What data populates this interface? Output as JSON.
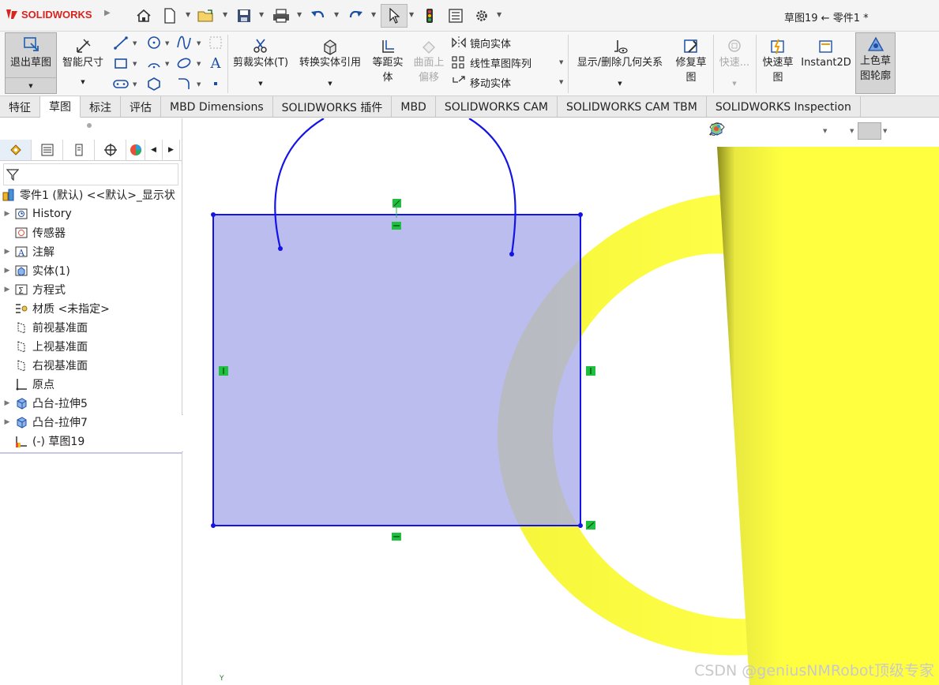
{
  "app": {
    "logo_text": "SOLIDWORKS",
    "title": "草图19 ← 零件1 *"
  },
  "quick_access": [
    "home-icon",
    "new-icon",
    "open-icon",
    "save-icon",
    "print-icon",
    "undo-icon",
    "redo-icon",
    "select-icon",
    "rebuild-icon",
    "file-properties-icon",
    "options-icon"
  ],
  "ribbon": {
    "exit_sketch": "退出草图",
    "smart_dimension": "智能尺寸",
    "trim": "剪裁实体(T)",
    "convert": "转换实体引用",
    "offset_line1": "等距实",
    "offset_line2": "体",
    "surface_offset_line1": "曲面上",
    "surface_offset_line2": "偏移",
    "mirror": "镜向实体",
    "linear_pattern": "线性草图阵列",
    "move": "移动实体",
    "display_relations": "显示/删除几何关系",
    "repair_line1": "修复草",
    "repair_line2": "图",
    "quick_snaps": "快速...",
    "rapid_line1": "快速草",
    "rapid_line2": "图",
    "instant2d": "Instant2D",
    "shaded_line1": "上色草",
    "shaded_line2": "图轮廓"
  },
  "tabs": [
    {
      "label": "特征",
      "active": false
    },
    {
      "label": "草图",
      "active": true
    },
    {
      "label": "标注",
      "active": false
    },
    {
      "label": "评估",
      "active": false
    },
    {
      "label": "MBD Dimensions",
      "active": false
    },
    {
      "label": "SOLIDWORKS 插件",
      "active": false
    },
    {
      "label": "MBD",
      "active": false
    },
    {
      "label": "SOLIDWORKS CAM",
      "active": false
    },
    {
      "label": "SOLIDWORKS CAM TBM",
      "active": false
    },
    {
      "label": "SOLIDWORKS Inspection",
      "active": false
    }
  ],
  "tree": {
    "root": "零件1 (默认) <<默认>_显示状",
    "items": [
      {
        "label": "History",
        "expandable": true
      },
      {
        "label": "传感器",
        "expandable": false
      },
      {
        "label": "注解",
        "expandable": true
      },
      {
        "label": "实体(1)",
        "expandable": true
      },
      {
        "label": "方程式",
        "expandable": true
      },
      {
        "label": "材质 <未指定>",
        "expandable": false
      },
      {
        "label": "前视基准面",
        "expandable": false
      },
      {
        "label": "上视基准面",
        "expandable": false
      },
      {
        "label": "右视基准面",
        "expandable": false
      },
      {
        "label": "原点",
        "expandable": false
      },
      {
        "label": "凸台-拉伸5",
        "expandable": true
      },
      {
        "label": "凸台-拉伸7",
        "expandable": true
      },
      {
        "label": "(-) 草图19",
        "expandable": false
      }
    ]
  },
  "colors": {
    "sketch_line": "#1414e6",
    "sketch_fill": "#b9bcef",
    "body_yellow": "#ffff40",
    "relation_green": "#1fbf3f",
    "logo_red": "#d8231f"
  },
  "watermark": "CSDN @geniusNMRobot顶级专家"
}
